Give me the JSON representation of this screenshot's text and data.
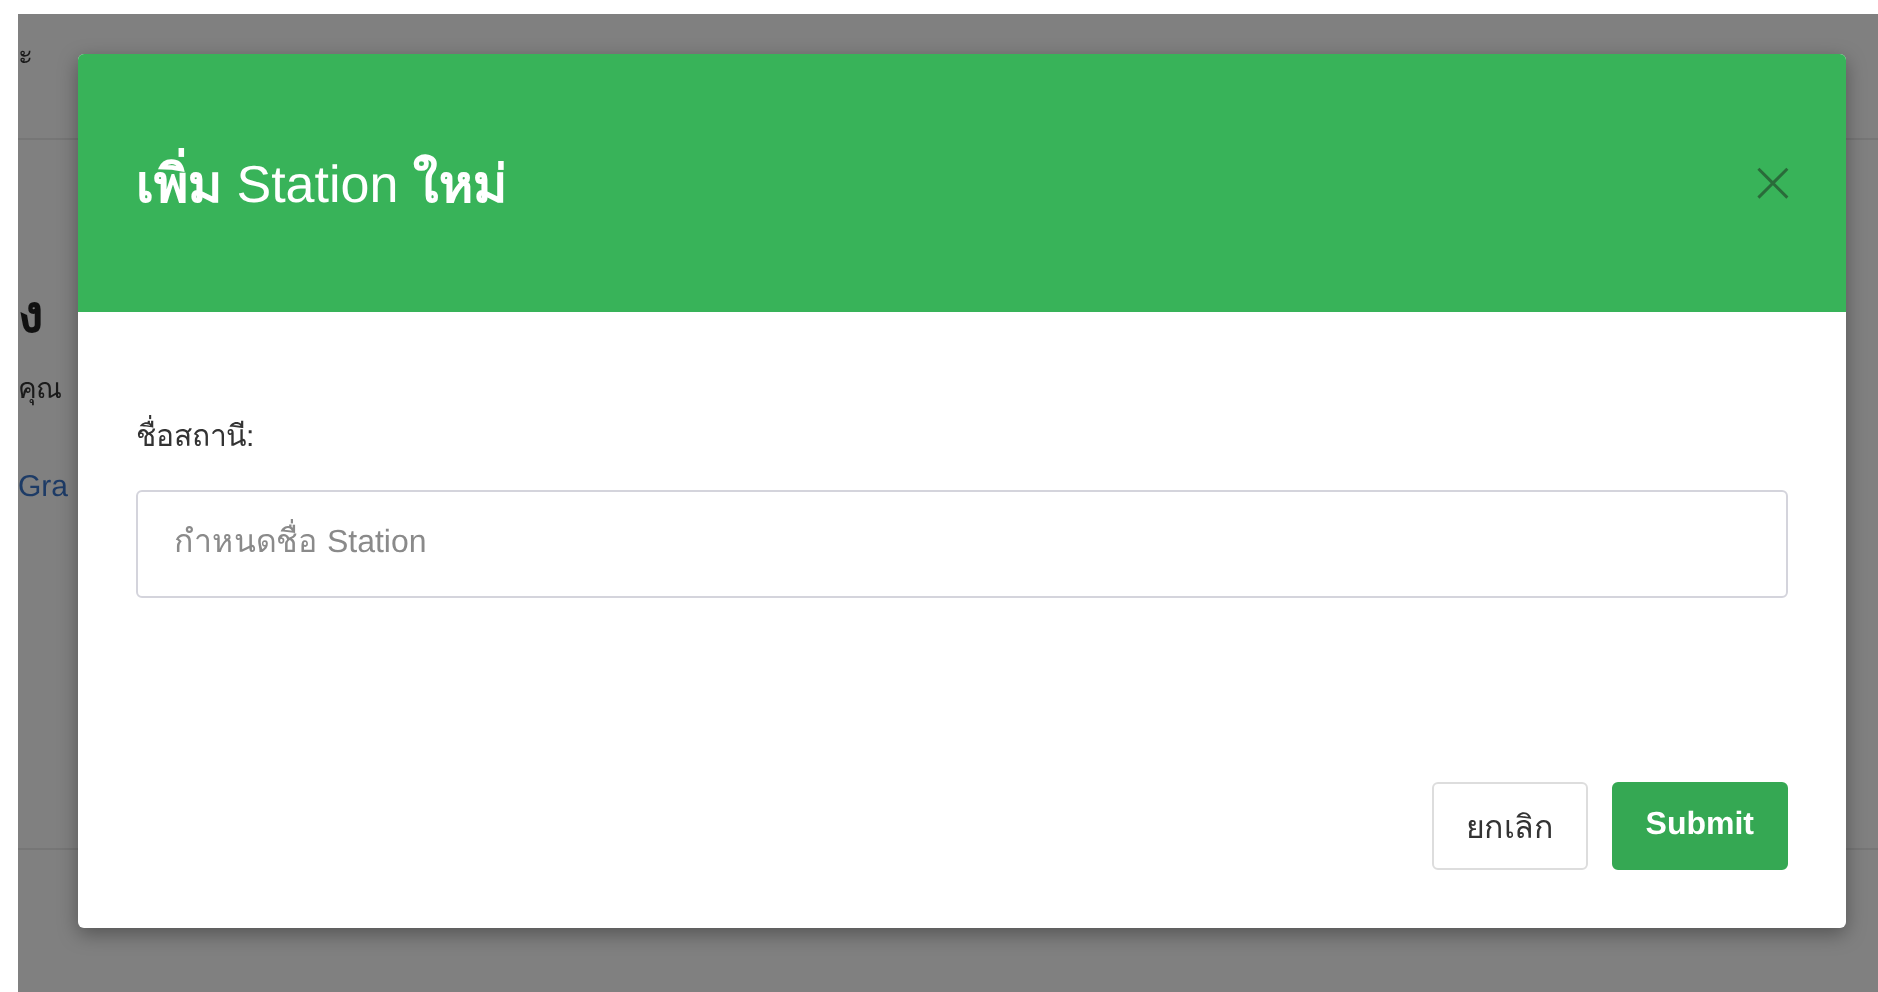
{
  "background_page": {
    "top_text": "ะ",
    "heading": "ง",
    "text": "คุณ",
    "link": "Gra"
  },
  "modal": {
    "title": "**เพิ่ม** Station **ใหม่**",
    "close": "×",
    "field": {
      "label": "ชื่อสถานี:",
      "placeholder": "กำหนดชื่อ Station"
    },
    "buttons": [
      {
        "label": "ยกเลิก",
        "kind": "secondary"
      },
      {
        "label": "Submit",
        "kind": "primary"
      }
    ]
  }
}
